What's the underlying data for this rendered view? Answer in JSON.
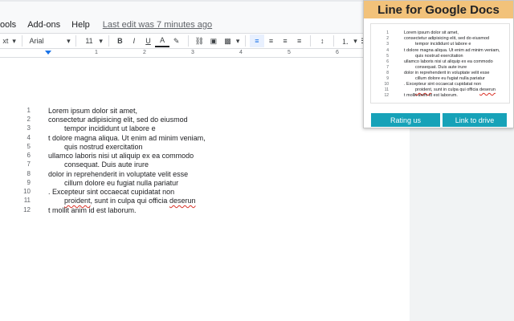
{
  "menu": {
    "tools": "ools",
    "addons": "Add-ons",
    "help": "Help",
    "last_edit": "Last edit was 7 minutes ago"
  },
  "toolbar": {
    "style": "xt",
    "font": "Arial",
    "size": "11",
    "bold": "B",
    "italic": "I",
    "underline": "U",
    "text_color": "A"
  },
  "ruler": {
    "ticks": [
      "1",
      "2",
      "3",
      "4",
      "5",
      "6"
    ]
  },
  "document": {
    "lines": [
      {
        "num": "1",
        "text": "Lorem ipsum dolor sit amet,"
      },
      {
        "num": "2",
        "text": "consectetur adipisicing elit, sed do eiusmod"
      },
      {
        "num": "3",
        "text": "tempor incididunt ut labore e"
      },
      {
        "num": "4",
        "text": "t dolore magna aliqua. Ut enim ad minim veniam,"
      },
      {
        "num": "5",
        "text": "quis nostrud exercitation"
      },
      {
        "num": "6",
        "text": "ullamco laboris nisi ut aliquip ex ea commodo"
      },
      {
        "num": "7",
        "text": "consequat. Duis aute irure"
      },
      {
        "num": "8",
        "text": "dolor in reprehenderit in voluptate velit esse"
      },
      {
        "num": "9",
        "text": "cillum dolore eu fugiat nulla pariatur"
      },
      {
        "num": "10",
        "text": ". Excepteur sint occaecat cupidatat non"
      },
      {
        "num": "11",
        "text_a": "proident",
        "text_b": ", sunt in culpa qui officia ",
        "text_c": "deserun"
      },
      {
        "num": "12",
        "text": "t mollit anim id est laborum."
      }
    ]
  },
  "popup": {
    "title": "Line for Google Docs",
    "preview_lines": [
      {
        "num": "1",
        "text": "Lorem ipsum dolor sit amet,"
      },
      {
        "num": "2",
        "text": "consectetur adipisicing elit, sed do eiusmod"
      },
      {
        "num": "3",
        "text": "tempor incididunt ut labore e"
      },
      {
        "num": "4",
        "text": "t dolore magna aliqua. Ut enim ad minim veniam,"
      },
      {
        "num": "5",
        "text": "quis nostrud exercitation"
      },
      {
        "num": "6",
        "text": "ullamco laboris nisi ut aliquip ex ea commodo"
      },
      {
        "num": "7",
        "text": "consequat. Duis aute irure"
      },
      {
        "num": "8",
        "text": "dolor in reprehenderit in voluptate velit esse"
      },
      {
        "num": "9",
        "text": "cillum dolore eu fugiat nulla pariatur"
      },
      {
        "num": "10",
        "text": ". Excepteur sint occaecat cupidatat non"
      },
      {
        "num": "11",
        "text_a": "proident",
        "text_b": ", sunt in culpa qui officia ",
        "text_c": "deserun"
      },
      {
        "num": "12",
        "text": "t mollit anim id est laborum."
      }
    ],
    "rating_label": "Rating us",
    "link_label": "Link to drive"
  },
  "colors": {
    "accent": "#17a2b8",
    "title_bg": "#f2c27a",
    "link_blue": "#1a73e8"
  }
}
